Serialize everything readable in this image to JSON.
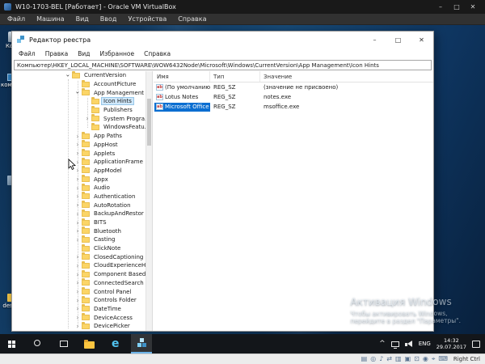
{
  "vbox": {
    "title": "W10-1703-BEL [Работает] - Oracle VM VirtualBox",
    "menu": [
      "Файл",
      "Машина",
      "Вид",
      "Ввод",
      "Устройства",
      "Справка"
    ],
    "hint": "Right Ctrl",
    "status_icons": [
      "hdd-icon",
      "cd-icon",
      "audio-icon",
      "network-icon",
      "usb-icon",
      "shared-folder-icon",
      "display-icon",
      "recording-icon",
      "mouse-icon",
      "keyboard-icon"
    ]
  },
  "desktop_icons": [
    {
      "label": "Ко...",
      "kind": "recycle-bin"
    },
    {
      "label": "компь...",
      "kind": "this-pc"
    },
    {
      "label": "",
      "kind": "shortcut"
    },
    {
      "label": "desk...",
      "kind": "folder"
    }
  ],
  "activation": {
    "title": "Активация Windows",
    "line1": "Чтобы активировать Windows,",
    "line2": "перейдите в раздел \"Параметры\"."
  },
  "regedit": {
    "title": "Редактор реестра",
    "menu": [
      "Файл",
      "Правка",
      "Вид",
      "Избранное",
      "Справка"
    ],
    "address": "Компьютер\\HKEY_LOCAL_MACHINE\\SOFTWARE\\WOW6432Node\\Microsoft\\Windows\\CurrentVersion\\App Management\\Icon Hints",
    "columns": [
      "Имя",
      "Тип",
      "Значение"
    ],
    "values": [
      {
        "name": "(По умолчанию)",
        "type": "REG_SZ",
        "value": "(значение не присвоено)",
        "selected": false
      },
      {
        "name": "Lotus Notes",
        "type": "REG_SZ",
        "value": "notes.exe",
        "selected": false
      },
      {
        "name": "Microsoft Office",
        "type": "REG_SZ",
        "value": "msoffice.exe",
        "selected": true
      }
    ],
    "tree": [
      {
        "label": "CurrentVersion",
        "level": 0,
        "chevron": "down",
        "selected": false
      },
      {
        "label": "AccountPicture",
        "level": 1,
        "chevron": "none",
        "selected": false
      },
      {
        "label": "App Management",
        "level": 1,
        "chevron": "down",
        "selected": false
      },
      {
        "label": "Icon Hints",
        "level": 2,
        "chevron": "none",
        "selected": true
      },
      {
        "label": "Publishers",
        "level": 2,
        "chevron": "none",
        "selected": false
      },
      {
        "label": "System Progra...",
        "level": 2,
        "chevron": "right",
        "selected": false
      },
      {
        "label": "WindowsFeatu...",
        "level": 2,
        "chevron": "none",
        "selected": false
      },
      {
        "label": "App Paths",
        "level": 1,
        "chevron": "right",
        "selected": false
      },
      {
        "label": "AppHost",
        "level": 1,
        "chevron": "right",
        "selected": false
      },
      {
        "label": "Applets",
        "level": 1,
        "chevron": "right",
        "selected": false
      },
      {
        "label": "ApplicationFrame",
        "level": 1,
        "chevron": "right",
        "selected": false
      },
      {
        "label": "AppModel",
        "level": 1,
        "chevron": "right",
        "selected": false
      },
      {
        "label": "Appx",
        "level": 1,
        "chevron": "right",
        "selected": false
      },
      {
        "label": "Audio",
        "level": 1,
        "chevron": "right",
        "selected": false
      },
      {
        "label": "Authentication",
        "level": 1,
        "chevron": "right",
        "selected": false
      },
      {
        "label": "AutoRotation",
        "level": 1,
        "chevron": "right",
        "selected": false
      },
      {
        "label": "BackupAndRestor",
        "level": 1,
        "chevron": "right",
        "selected": false
      },
      {
        "label": "BITS",
        "level": 1,
        "chevron": "right",
        "selected": false
      },
      {
        "label": "Bluetooth",
        "level": 1,
        "chevron": "right",
        "selected": false
      },
      {
        "label": "Casting",
        "level": 1,
        "chevron": "right",
        "selected": false
      },
      {
        "label": "ClickNote",
        "level": 1,
        "chevron": "none",
        "selected": false
      },
      {
        "label": "ClosedCaptioning",
        "level": 1,
        "chevron": "right",
        "selected": false
      },
      {
        "label": "CloudExperienceH",
        "level": 1,
        "chevron": "right",
        "selected": false
      },
      {
        "label": "Component Based",
        "level": 1,
        "chevron": "right",
        "selected": false
      },
      {
        "label": "ConnectedSearch",
        "level": 1,
        "chevron": "right",
        "selected": false
      },
      {
        "label": "Control Panel",
        "level": 1,
        "chevron": "right",
        "selected": false
      },
      {
        "label": "Controls Folder",
        "level": 1,
        "chevron": "right",
        "selected": false
      },
      {
        "label": "DateTime",
        "level": 1,
        "chevron": "right",
        "selected": false
      },
      {
        "label": "DeviceAccess",
        "level": 1,
        "chevron": "right",
        "selected": false
      },
      {
        "label": "DevicePicker",
        "level": 1,
        "chevron": "right",
        "selected": false
      }
    ]
  },
  "taskbar": {
    "buttons": [
      "start",
      "search",
      "task-view",
      "file-explorer",
      "edge",
      "regedit"
    ],
    "active": "regedit",
    "lang": "ENG",
    "time": "14:32",
    "date": "29.07.2017"
  }
}
